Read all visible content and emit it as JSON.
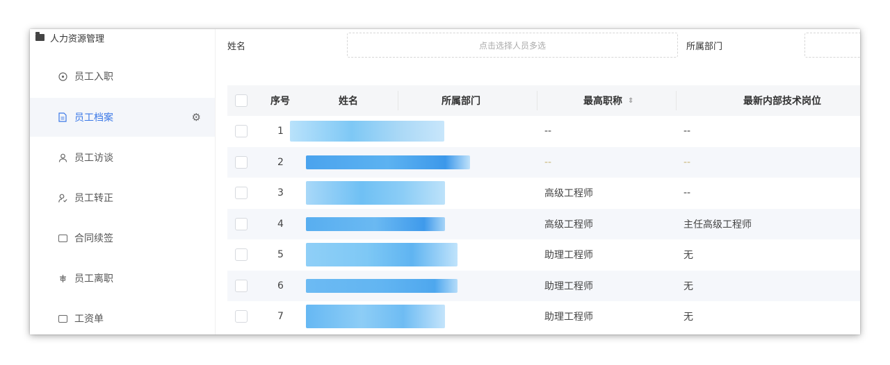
{
  "sidebar": {
    "header": "人力资源管理",
    "items": [
      {
        "label": "员工入职",
        "icon": "clock-icon"
      },
      {
        "label": "员工档案",
        "icon": "document-icon",
        "active": true
      },
      {
        "label": "员工访谈",
        "icon": "user-icon"
      },
      {
        "label": "员工转正",
        "icon": "user-check-icon"
      },
      {
        "label": "合同续签",
        "icon": "contract-icon"
      },
      {
        "label": "员工离职",
        "icon": "exit-icon"
      },
      {
        "label": "工资单",
        "icon": "payslip-icon"
      }
    ]
  },
  "filters": {
    "name_label": "姓名",
    "name_placeholder": "点击选择人员多选",
    "dept_label": "所属部门",
    "dept_placeholder": ""
  },
  "table": {
    "headers": {
      "index": "序号",
      "name": "姓名",
      "dept": "所属部门",
      "title": "最高职称",
      "position": "最新内部技术岗位"
    },
    "rows": [
      {
        "index": "1",
        "title": "--",
        "position": "--"
      },
      {
        "index": "2",
        "title": "--",
        "position": "--"
      },
      {
        "index": "3",
        "title": "高级工程师",
        "position": "--"
      },
      {
        "index": "4",
        "title": "高级工程师",
        "position": "主任高级工程师"
      },
      {
        "index": "5",
        "title": "助理工程师",
        "position": "无"
      },
      {
        "index": "6",
        "title": "助理工程师",
        "position": "无"
      },
      {
        "index": "7",
        "title": "助理工程师",
        "position": "无"
      }
    ]
  },
  "colors": {
    "accent": "#3b78e7",
    "redaction": "#7ec8f5"
  }
}
